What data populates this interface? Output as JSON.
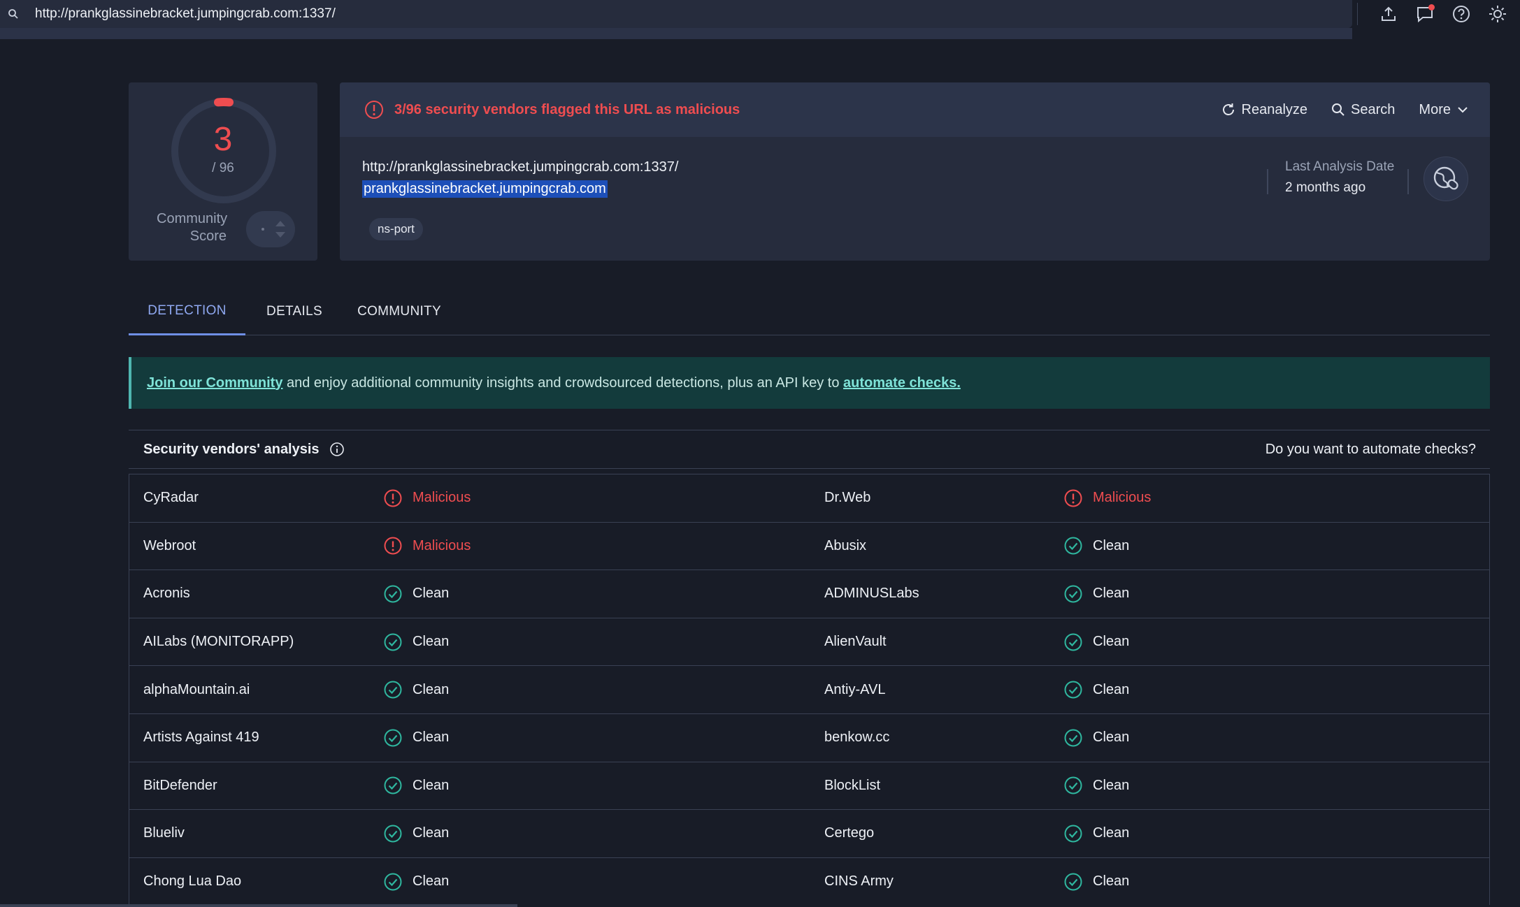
{
  "topbar": {
    "url": "http://prankglassinebracket.jumpingcrab.com:1337/"
  },
  "score": {
    "detections": "3",
    "total": "/ 96",
    "community_label": "Community\nScore"
  },
  "info": {
    "alert": "3/96 security vendors flagged this URL as malicious",
    "reanalyze": "Reanalyze",
    "search": "Search",
    "more": "More",
    "url": "http://prankglassinebracket.jumpingcrab.com:1337/",
    "host": "prankglassinebracket.jumpingcrab.com",
    "tag": "ns-port",
    "last_analysis_label": "Last Analysis Date",
    "last_analysis_value": "2 months ago"
  },
  "tabs": [
    "DETECTION",
    "DETAILS",
    "COMMUNITY"
  ],
  "banner": {
    "link1": "Join our Community",
    "text": " and enjoy additional community insights and crowdsourced detections, plus an API key to ",
    "link2": "automate checks."
  },
  "vendors": {
    "title": "Security vendors' analysis",
    "automate": "Do you want to automate checks?",
    "rows": [
      [
        {
          "name": "CyRadar",
          "result": "Malicious"
        },
        {
          "name": "Dr.Web",
          "result": "Malicious"
        }
      ],
      [
        {
          "name": "Webroot",
          "result": "Malicious"
        },
        {
          "name": "Abusix",
          "result": "Clean"
        }
      ],
      [
        {
          "name": "Acronis",
          "result": "Clean"
        },
        {
          "name": "ADMINUSLabs",
          "result": "Clean"
        }
      ],
      [
        {
          "name": "AILabs (MONITORAPP)",
          "result": "Clean"
        },
        {
          "name": "AlienVault",
          "result": "Clean"
        }
      ],
      [
        {
          "name": "alphaMountain.ai",
          "result": "Clean"
        },
        {
          "name": "Antiy-AVL",
          "result": "Clean"
        }
      ],
      [
        {
          "name": "Artists Against 419",
          "result": "Clean"
        },
        {
          "name": "benkow.cc",
          "result": "Clean"
        }
      ],
      [
        {
          "name": "BitDefender",
          "result": "Clean"
        },
        {
          "name": "BlockList",
          "result": "Clean"
        }
      ],
      [
        {
          "name": "Blueliv",
          "result": "Clean"
        },
        {
          "name": "Certego",
          "result": "Clean"
        }
      ],
      [
        {
          "name": "Chong Lua Dao",
          "result": "Clean"
        },
        {
          "name": "CINS Army",
          "result": "Clean"
        }
      ]
    ]
  },
  "colors": {
    "malicious": "#ef4d50",
    "clean": "#2fb79f",
    "accent": "#6f8fe6"
  }
}
